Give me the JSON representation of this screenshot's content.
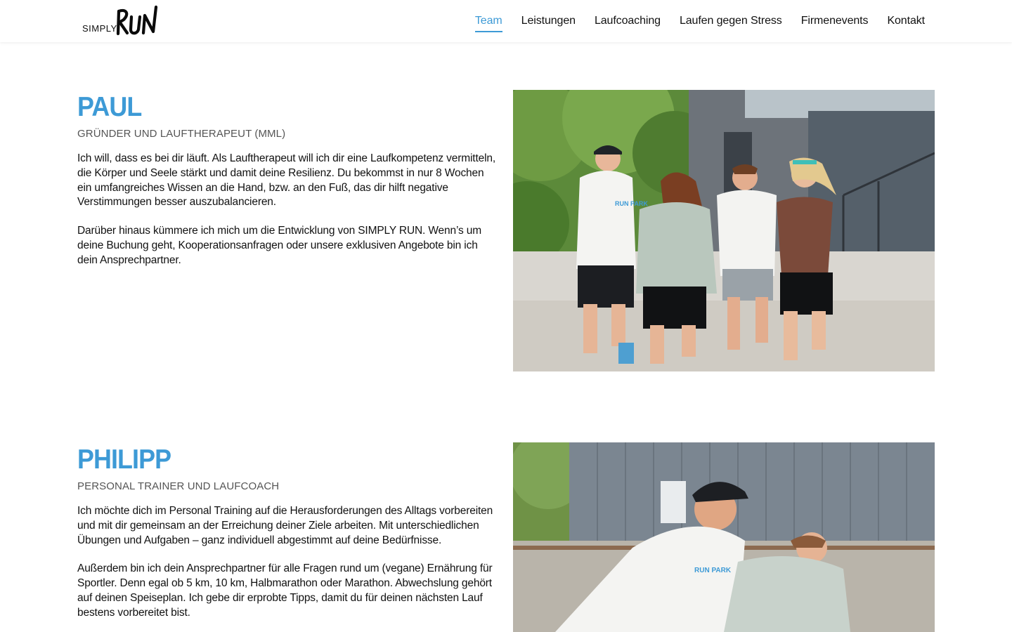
{
  "brand": {
    "simply": "SIMPLY",
    "run": "RUN"
  },
  "nav": {
    "items": [
      {
        "label": "Team",
        "active": true
      },
      {
        "label": "Leistungen",
        "active": false
      },
      {
        "label": "Laufcoaching",
        "active": false
      },
      {
        "label": "Laufen gegen Stress",
        "active": false
      },
      {
        "label": "Firmenevents",
        "active": false
      },
      {
        "label": "Kontakt",
        "active": false
      }
    ]
  },
  "team": [
    {
      "name": "PAUL",
      "role": "GRÜNDER UND LAUFTHERAPEUT (MML)",
      "paragraphs": [
        "Ich will, dass es bei dir läuft. Als Lauftherapeut will ich dir eine Laufkompetenz vermitteln, die Körper und Seele stärkt und damit deine Resilienz. Du bekommst in nur 8 Wochen ein umfangreiches Wissen an die Hand, bzw. an den Fuß, das dir hilft negative Verstimmungen besser auszubalancieren.",
        "Darüber hinaus kümmere ich mich um die Entwicklung von SIMPLY RUN. Wenn’s um deine Buchung geht, Kooperationsanfragen oder unsere exklusiven Angebote bin ich dein Ansprechpartner."
      ],
      "photo_shirt_print": "RUN PARK"
    },
    {
      "name": "PHILIPP",
      "role": "PERSONAL TRAINER UND LAUFCOACH",
      "paragraphs": [
        "Ich möchte dich im Personal Training auf die Herausforderungen des Alltags vorbereiten und mit dir gemeinsam an der Erreichung deiner Ziele arbeiten. Mit unterschiedlichen Übungen und Aufgaben – ganz individuell abgestimmt auf deine Bedürfnisse.",
        "Außerdem bin ich dein Ansprechpartner für alle Fragen rund um (vegane) Ernährung für Sportler. Denn egal ob 5 km, 10 km, Halbmarathon oder Marathon. Abwechslung gehört auf deinen Speiseplan. Ich gebe dir erprobte Tipps, damit du für deinen nächsten Lauf bestens vorbereitet bist."
      ],
      "photo_shirt_print": "RUN PARK"
    }
  ],
  "colors": {
    "accent": "#3d9ad6",
    "text": "#111111",
    "muted": "#555555"
  }
}
